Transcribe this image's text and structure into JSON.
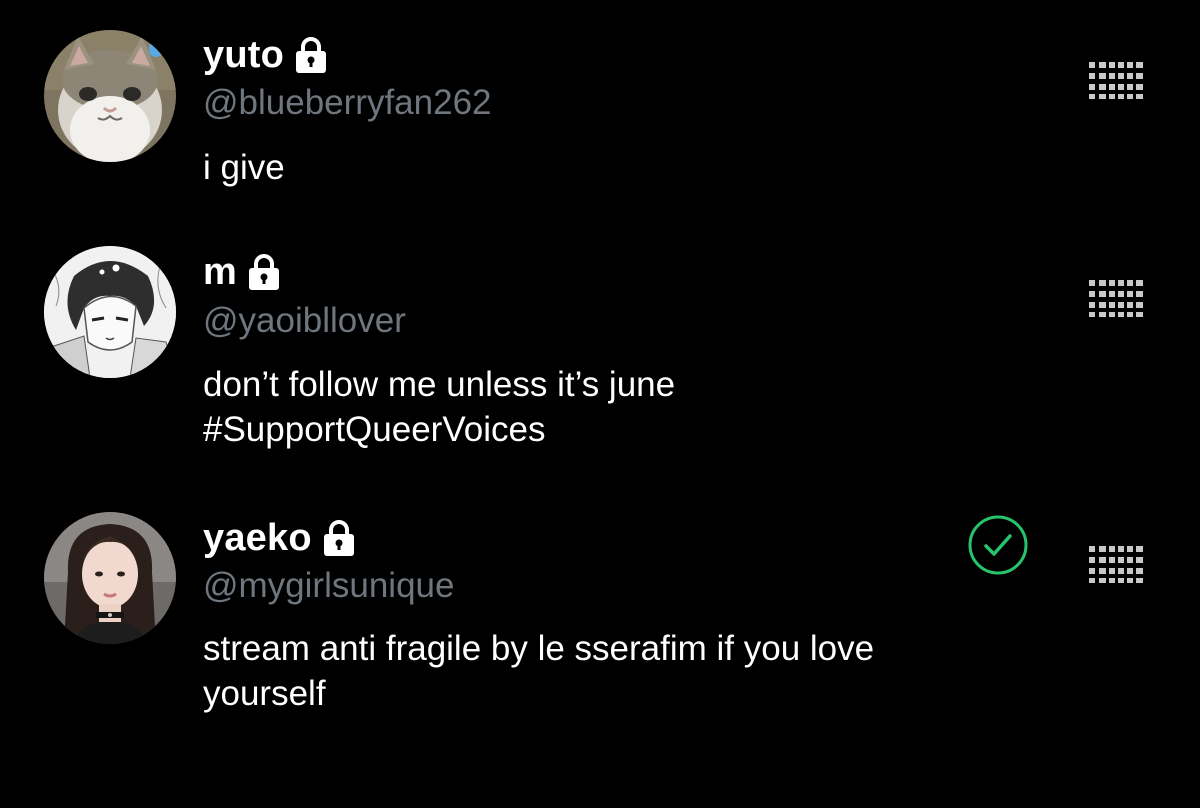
{
  "accent_color": "#27c46b",
  "handle_color": "#6f767d",
  "accounts": [
    {
      "display_name": "yuto",
      "locked": true,
      "handle": "@blueberryfan262",
      "bio_lines": [
        "i give"
      ],
      "avatar_icon": "cat-avatar",
      "following": false
    },
    {
      "display_name": "m",
      "locked": true,
      "handle": "@yaoibllover",
      "bio_lines": [
        "don’t follow me unless it’s june",
        "#SupportQueerVoices"
      ],
      "avatar_icon": "anime-sketch-avatar",
      "following": false
    },
    {
      "display_name": "yaeko",
      "locked": true,
      "handle": "@mygirlsunique",
      "bio_lines": [
        "stream anti fragile by le sserafim if you love",
        "yourself"
      ],
      "avatar_icon": "person-photo-avatar",
      "following": true
    }
  ]
}
